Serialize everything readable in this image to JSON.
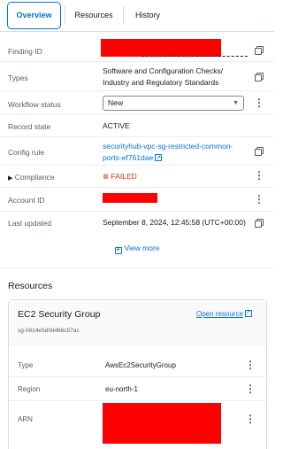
{
  "tabs": [
    {
      "label": "Overview",
      "active": true
    },
    {
      "label": "Resources",
      "active": false
    },
    {
      "label": "History",
      "active": false
    }
  ],
  "details": {
    "finding_id_label": "Finding ID",
    "types_label": "Types",
    "types_value_line1": "Software and Configuration Checks/",
    "types_value_line2": "Industry and Regulatory Standards",
    "workflow_label": "Workflow status",
    "workflow_value": "New",
    "record_state_label": "Record state",
    "record_state_value": "ACTIVE",
    "config_rule_label": "Config rule",
    "config_rule_line1": "securityhub-vpc-sg-restricted-common-",
    "config_rule_line2": "ports-ef761dae",
    "compliance_label": "Compliance",
    "compliance_value": "FAILED",
    "account_id_label": "Account ID",
    "last_updated_label": "Last updated",
    "last_updated_value": "September 8, 2024, 12:45:58 (UTC+00:00)",
    "view_more": "View more"
  },
  "resources": {
    "section_title": "Resources",
    "card_title": "EC2 Security Group",
    "card_subtitle": "sg-0814e5d0d466c57ac",
    "open_resource": "Open resource",
    "type_label": "Type",
    "type_value": "AwsEc2SecurityGroup",
    "region_label": "Region",
    "region_value": "eu-north-1",
    "arn_label": "ARN"
  },
  "colors": {
    "accent": "#0972d3",
    "failed": "#d13212",
    "redaction": "#ff0000"
  }
}
